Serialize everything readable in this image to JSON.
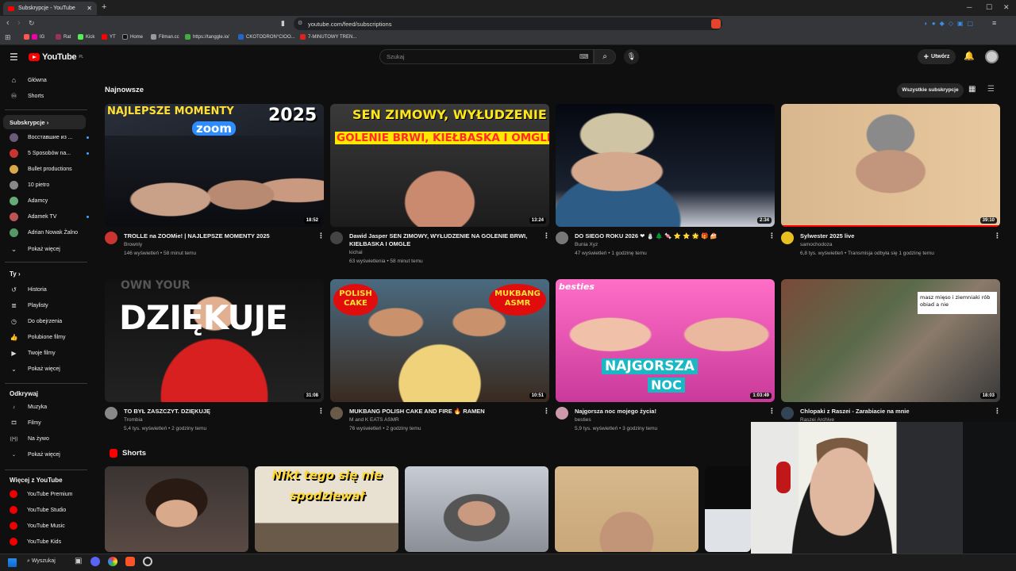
{
  "browser": {
    "tab_title": "Subskrypcje - YouTube",
    "url": "youtube.com/feed/subscriptions",
    "bookmarks": [
      "IG",
      "Rat",
      "Kick",
      "YT",
      "Home",
      "Filman.cc",
      "https://tanggle.io/",
      "CKOTODRON°CIOO...",
      "7-MINUTOWY TREN..."
    ]
  },
  "header": {
    "logo": "YouTube",
    "country": "PL",
    "search_placeholder": "Szukaj",
    "create_label": "Utwórz"
  },
  "sidebar": {
    "main": [
      {
        "label": "Główna",
        "icon": "home-icon"
      },
      {
        "label": "Shorts",
        "icon": "shorts-icon"
      }
    ],
    "subs_header": "Subskrypcje",
    "subs": [
      {
        "label": "Восставшие из ...",
        "color": "#6b5b7a",
        "dot": true
      },
      {
        "label": "5 Sposobów na...",
        "color": "#c33",
        "dot": true
      },
      {
        "label": "Bullet productions",
        "color": "#d9a84a",
        "dot": false
      },
      {
        "label": "10 pietro",
        "color": "#888",
        "dot": false
      },
      {
        "label": "Adamcy",
        "color": "#6a7",
        "dot": false
      },
      {
        "label": "Adamek TV",
        "color": "#b55",
        "dot": true
      },
      {
        "label": "Adrian Nowak Żalno",
        "color": "#596",
        "dot": false
      }
    ],
    "show_more": "Pokaż więcej",
    "you_header": "Ty",
    "you": [
      {
        "label": "Historia",
        "icon": "history-icon"
      },
      {
        "label": "Playlisty",
        "icon": "playlist-icon"
      },
      {
        "label": "Do obejrzenia",
        "icon": "clock-icon"
      },
      {
        "label": "Polubione filmy",
        "icon": "like-icon"
      },
      {
        "label": "Twoje filmy",
        "icon": "video-icon"
      },
      {
        "label": "Pokaż więcej",
        "icon": "chevron-down-icon"
      }
    ],
    "explore_header": "Odkrywaj",
    "explore": [
      {
        "label": "Muzyka",
        "icon": "music-icon"
      },
      {
        "label": "Filmy",
        "icon": "film-icon"
      },
      {
        "label": "Na żywo",
        "icon": "live-icon"
      },
      {
        "label": "Pokaż więcej",
        "icon": "chevron-down-icon"
      }
    ],
    "more_header": "Więcej z YouTube",
    "more": [
      {
        "label": "YouTube Premium"
      },
      {
        "label": "YouTube Studio"
      },
      {
        "label": "YouTube Music"
      },
      {
        "label": "YouTube Kids"
      }
    ]
  },
  "feed": {
    "section_title": "Najnowsze",
    "all_subs": "Wszystkie subskrypcje",
    "videos": [
      {
        "title": "TROLLE na ZOOMie! | NAJLEPSZE MOMENTY 2025",
        "channel": "Brownly",
        "meta": "146 wyświetleń • 58 minut temu",
        "duration": "18:52",
        "thumb_text": "NAJLEPSZE MOMENTY",
        "thumb_text2": "2025",
        "thumb_text3": "zoom"
      },
      {
        "title": "Dawid Jasper SEN ZIMOWY, WYŁUDZENIE NA GOLENIE BRWI, KIEŁBASKA I OMGLE",
        "channel": "kichal",
        "meta": "63 wyświetlenia • 58 minut temu",
        "duration": "13:24",
        "thumb_text": "SEN ZIMOWY, WYŁUDZENIE NA",
        "thumb_text2": "GOLENIE BRWI, KIEŁBASKA I OMGLE"
      },
      {
        "title": "DO SIEGO ROKU 2026 ❤ ⛄ 🌲 🍬 ⭐ ⭐ 🌟 🎁 🍰",
        "channel": "Bunia Xyz",
        "meta": "47 wyświetleń • 1 godzinę temu",
        "duration": "2:34"
      },
      {
        "title": "Sylwester 2025 live",
        "channel": "samochodoza",
        "meta": "6,8 tys. wyświetleń • Transmisja odbyła się 1 godzinę temu",
        "duration": "39:10"
      },
      {
        "title": "TO BYŁ ZASZCZYT. DZIĘKUJĘ",
        "channel": "Trombia",
        "meta": "5,4 tys. wyświetleń • 2 godziny temu",
        "duration": "31:08",
        "thumb_text": "DZIĘKUJE",
        "thumb_text2": "OWN YOUR"
      },
      {
        "title": "MUKBANG POLISH CAKE AND FIRE 🔥 RAMEN",
        "channel": "M and K EATS ASMR",
        "meta": "76 wyświetleń • 2 godziny temu",
        "duration": "10:51",
        "thumb_text": "POLISH CAKE",
        "thumb_text2": "MUKBANG ASMR"
      },
      {
        "title": "Najgorsza noc mojego życia!",
        "channel": "besties",
        "meta": "5,9 tys. wyświetleń • 3 godziny temu",
        "duration": "1:03:49",
        "thumb_text": "NAJGORSZA",
        "thumb_text2": "NOC",
        "thumb_text3": "besties"
      },
      {
        "title": "Chlopaki z Raszei - Zarabiacie na mnie",
        "channel": "Raszei Archive",
        "meta": "",
        "duration": "18:03",
        "thumb_text": "masz mięso i ziemniaki rób obiad a nie"
      }
    ]
  },
  "shorts": {
    "title": "Shorts",
    "items": [
      {
        "text": ""
      },
      {
        "text": "Nikt tego się nie spodziewał"
      },
      {
        "text": ""
      },
      {
        "text": ""
      }
    ]
  },
  "taskbar": {
    "search": "Wyszukaj"
  }
}
